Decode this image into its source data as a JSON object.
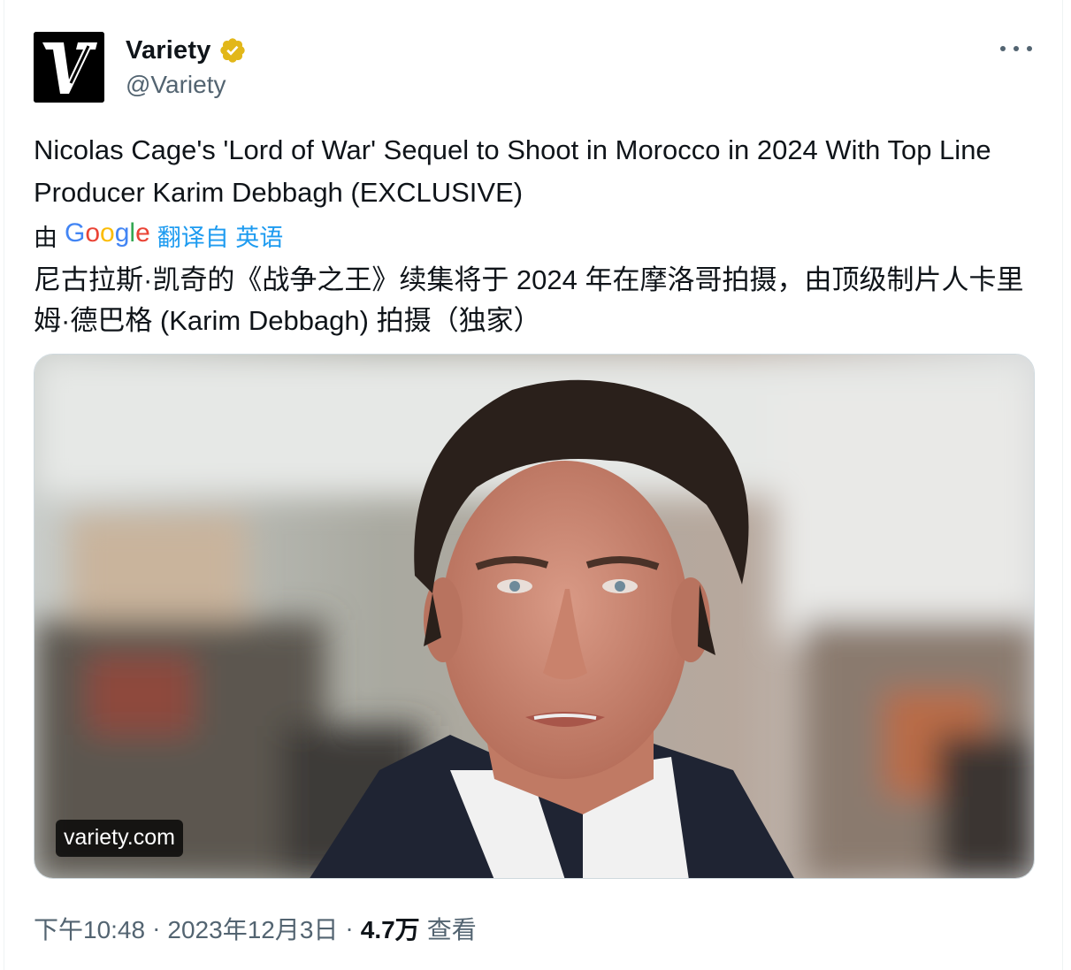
{
  "author": {
    "display_name": "Variety",
    "handle": "@Variety",
    "avatar_letter": "V",
    "verified_icon": "verified-badge-icon",
    "verified_color": "#e2b719"
  },
  "tweet": {
    "text": "Nicolas Cage's 'Lord of War' Sequel to Shoot in Morocco in 2024 With Top Line Producer Karim Debbagh (EXCLUSIVE)",
    "translation": {
      "by_label": "由",
      "provider": "Google",
      "link_label": "翻译自 英语",
      "text": "尼古拉斯·凯奇的《战争之王》续集将于 2024 年在摩洛哥拍摄，由顶级制片人卡里姆·德巴格 (Karim Debbagh) 拍摄（独家）"
    }
  },
  "media": {
    "domain": "variety.com"
  },
  "meta": {
    "time": "下午10:48",
    "separator": "·",
    "date": "2023年12月3日",
    "views_count": "4.7万",
    "views_label": "查看"
  },
  "colors": {
    "text_primary": "#0f1419",
    "text_secondary": "#536471",
    "link": "#1d9bf0",
    "border": "#cfd9de"
  },
  "icons": {
    "more": "more-options-icon"
  }
}
